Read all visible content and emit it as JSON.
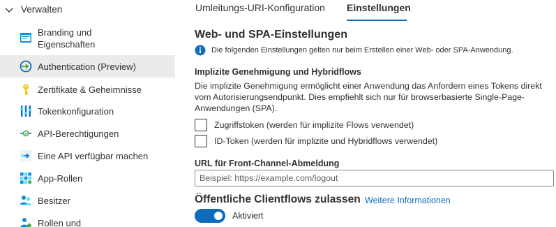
{
  "sidebar": {
    "group_label": "Verwalten",
    "items": [
      {
        "label_line1": "Branding und",
        "label_line2": "Eigenschaften",
        "icon": "branding-icon"
      },
      {
        "label": "Authentication (Preview)",
        "icon": "authentication-icon",
        "active": true
      },
      {
        "label": "Zertifikate & Geheimnisse",
        "icon": "key-icon"
      },
      {
        "label": "Tokenkonfiguration",
        "icon": "token-configuration-icon"
      },
      {
        "label": "API-Berechtigungen",
        "icon": "api-permissions-icon"
      },
      {
        "label": "Eine API verfügbar machen",
        "icon": "expose-api-icon"
      },
      {
        "label": "App-Rollen",
        "icon": "app-roles-icon"
      },
      {
        "label": "Besitzer",
        "icon": "owners-icon"
      },
      {
        "label": "Rollen und",
        "icon": "roles-icon"
      }
    ]
  },
  "tabs": [
    {
      "label": "Umleitungs-URI-Konfiguration",
      "selected": false
    },
    {
      "label": "Einstellungen",
      "selected": true
    }
  ],
  "main": {
    "heading": "Web- und SPA-Einstellungen",
    "info_text": "Die folgenden Einstellungen gelten nur beim Erstellen einer Web- oder SPA-Anwendung.",
    "implicit_heading": "Implizite Genehmigung und Hybridflows",
    "implicit_description": "Die implizite Genehmigung ermöglicht einer Anwendung das Anfordern eines Tokens direkt vom Autorisierungsendpunkt. Dies empfiehlt sich nur für browserbasierte Single-Page-Anwendungen (SPA).",
    "checkboxes": [
      {
        "label": "Zugriffstoken (werden für implizite Flows verwendet)",
        "checked": false
      },
      {
        "label": "ID-Token (werden für implizite und Hybridflows verwendet)",
        "checked": false
      }
    ],
    "logout_label": "URL für Front-Channel-Abmeldung",
    "logout_value": "",
    "logout_placeholder": "Beispiel: https://example.com/logout",
    "public_client_heading": "Öffentliche Clientflows zulassen",
    "more_info_link": "Weitere Informationen",
    "toggle_label": "Aktiviert",
    "toggle_on": true
  },
  "colors": {
    "accent": "#0f6cbd",
    "active_item_bg": "#edebe9",
    "text": "#323130"
  }
}
